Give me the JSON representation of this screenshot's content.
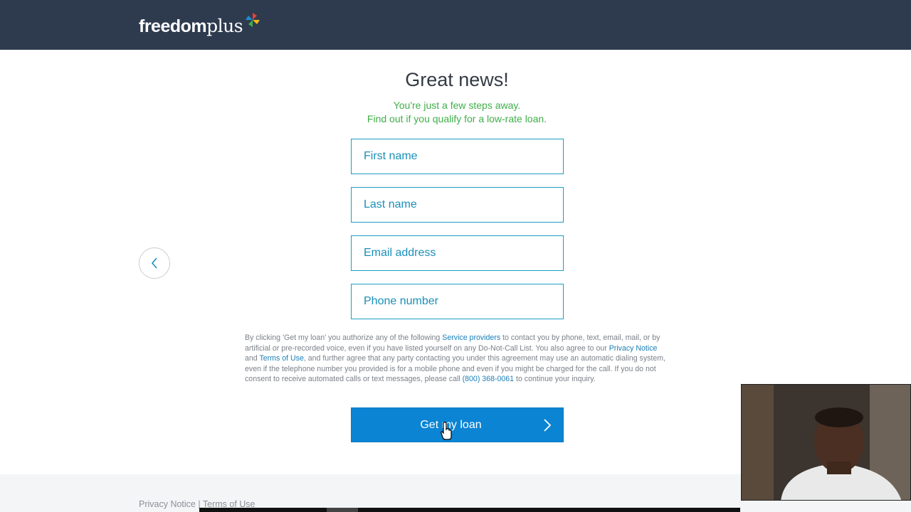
{
  "header": {
    "logo_bold": "freedom",
    "logo_light": "plus",
    "logo_mark_colors": [
      "#e8403a",
      "#f5b81c",
      "#3fae49",
      "#1a8fd0"
    ]
  },
  "main": {
    "headline": "Great news!",
    "subtitle_line1": "You're just a few steps away.",
    "subtitle_line2": "Find out if you qualify for a low-rate loan."
  },
  "form": {
    "first_name": {
      "placeholder": "First name",
      "value": ""
    },
    "last_name": {
      "placeholder": "Last name",
      "value": ""
    },
    "email": {
      "placeholder": "Email address",
      "value": ""
    },
    "phone": {
      "placeholder": "Phone number",
      "value": ""
    },
    "back_icon": "chevron-left-icon"
  },
  "disclaimer": {
    "part1": "By clicking 'Get my loan' you authorize any of the following ",
    "link_service": "Service providers",
    "part2": " to contact you by phone, text, email, mail, or by artificial or pre-recorded voice, even if you have listed yourself on any Do-Not-Call List. You also agree to our ",
    "link_privacy": "Privacy Notice",
    "part3": " and ",
    "link_terms": "Terms of Use",
    "part4": ", and further agree that any party contacting you under this agreement may use an automatic dialing system, even if the telephone number you provided is for a mobile phone and even if you might be charged for the call. If you do not consent to receive automated calls or text messages, please call ",
    "link_phone": "(800) 368-0061",
    "part5": " to continue your inquiry."
  },
  "cta": {
    "label": "Get my loan",
    "icon": "chevron-right-icon"
  },
  "footer": {
    "privacy": "Privacy Notice",
    "separator": "|",
    "terms": "Terms of Use"
  },
  "colors": {
    "header_bg": "#2e3b4f",
    "accent_green": "#3fae49",
    "field_border": "#1a9ec3",
    "cta_bg": "#0b84d4"
  }
}
